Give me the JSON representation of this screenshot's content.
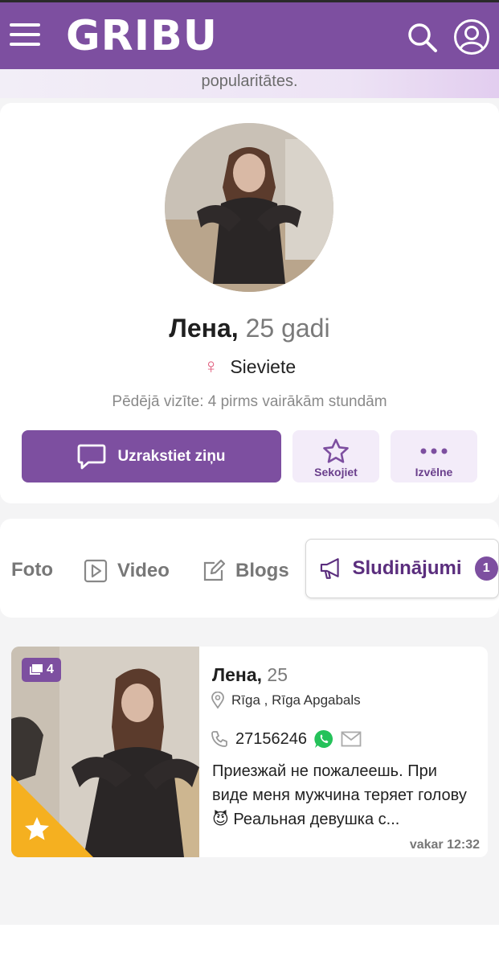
{
  "header": {
    "logo": "GRIBU",
    "menu_icon": "hamburger-menu-icon",
    "search_icon": "search-icon",
    "user_icon": "user-account-icon",
    "brand_color": "#7d4fa0"
  },
  "banner": {
    "text": "popularitātes."
  },
  "profile": {
    "name": "Лена,",
    "age": "25 gadi",
    "gender": "Sieviete",
    "gender_icon": "female-symbol-icon",
    "last_visit": "Pēdējā vizīte: 4 pirms vairākām stundām",
    "actions": {
      "message_label": "Uzrakstiet ziņu",
      "follow_label": "Sekojiet",
      "menu_label": "Izvēlne"
    }
  },
  "tabs": [
    {
      "label": "Foto",
      "icon": "photo-icon"
    },
    {
      "label": "Video",
      "icon": "video-play-icon"
    },
    {
      "label": "Blogs",
      "icon": "edit-pencil-icon"
    },
    {
      "label": "Sludinājumi",
      "icon": "megaphone-icon",
      "count": "1",
      "active": true
    }
  ],
  "listing": {
    "photo_count": "4",
    "name": "Лена,",
    "age": "25",
    "location": "Rīga ,  Rīga Apgabals",
    "phone": "27156246",
    "description": "Приезжай не пожалеешь. При виде меня мужчина теряет голову 😈 Реальная девушка с...",
    "time": "vakar 12:32",
    "featured_color": "#f5b020"
  }
}
